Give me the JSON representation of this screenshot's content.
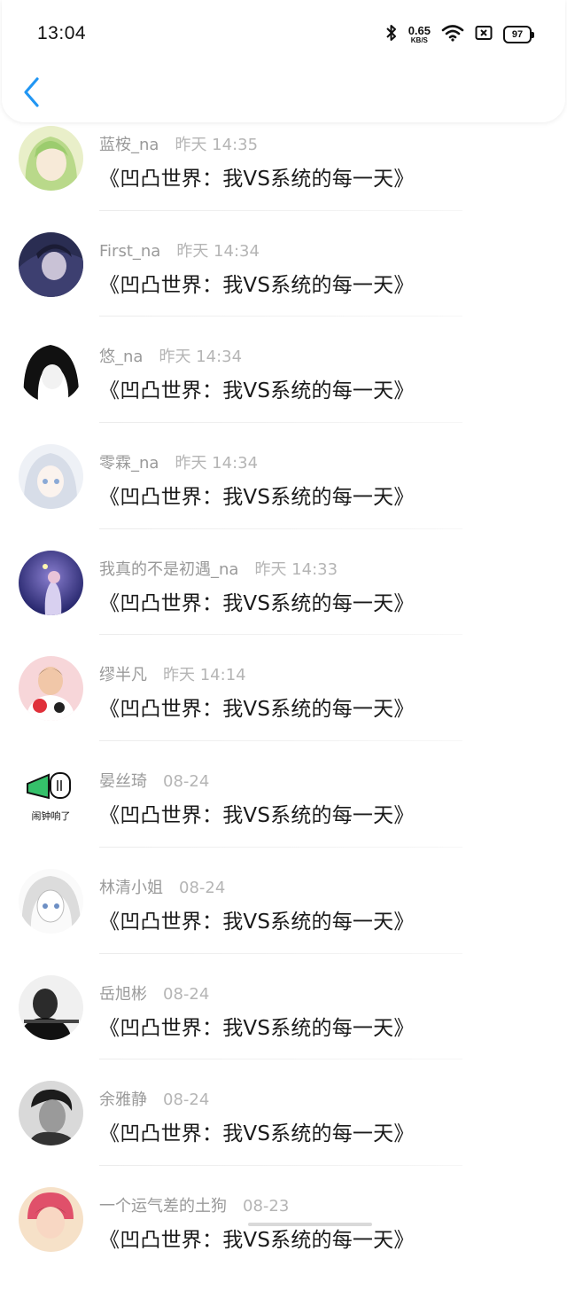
{
  "status_bar": {
    "time": "13:04",
    "net_speed_value": "0.65",
    "net_speed_unit": "KB/S",
    "battery": "97"
  },
  "colors": {
    "accent": "#2196f3",
    "name_text": "#9a9a9a",
    "time_text": "#b5b5b5",
    "content_text": "#1a1a1a"
  },
  "icons": {
    "back": "back-chevron-icon",
    "bluetooth": "bluetooth-icon",
    "wifi": "wifi-icon",
    "sim": "sim-off-icon",
    "battery": "battery-icon"
  },
  "items": [
    {
      "name": "蓝桉_na",
      "time": "昨天 14:35",
      "text": "《凹凸世界：我VS系统的每一天》"
    },
    {
      "name": "First_na",
      "time": "昨天 14:34",
      "text": "《凹凸世界：我VS系统的每一天》"
    },
    {
      "name": "悠_na",
      "time": "昨天 14:34",
      "text": "《凹凸世界：我VS系统的每一天》"
    },
    {
      "name": "零霖_na",
      "time": "昨天 14:34",
      "text": "《凹凸世界：我VS系统的每一天》"
    },
    {
      "name": "我真的不是初遇_na",
      "time": "昨天 14:33",
      "text": "《凹凸世界：我VS系统的每一天》"
    },
    {
      "name": "缪半凡",
      "time": "昨天 14:14",
      "text": "《凹凸世界：我VS系统的每一天》"
    },
    {
      "name": "晏丝琦",
      "time": "08-24",
      "text": "《凹凸世界：我VS系统的每一天》",
      "avatar_caption": "闹钟响了"
    },
    {
      "name": "林清小姐",
      "time": "08-24",
      "text": "《凹凸世界：我VS系统的每一天》"
    },
    {
      "name": "岳旭彬",
      "time": "08-24",
      "text": "《凹凸世界：我VS系统的每一天》"
    },
    {
      "name": "余雅静",
      "time": "08-24",
      "text": "《凹凸世界：我VS系统的每一天》"
    },
    {
      "name": "一个运气差的土狗",
      "time": "08-23",
      "text": "《凹凸世界：我VS系统的每一天》"
    }
  ]
}
